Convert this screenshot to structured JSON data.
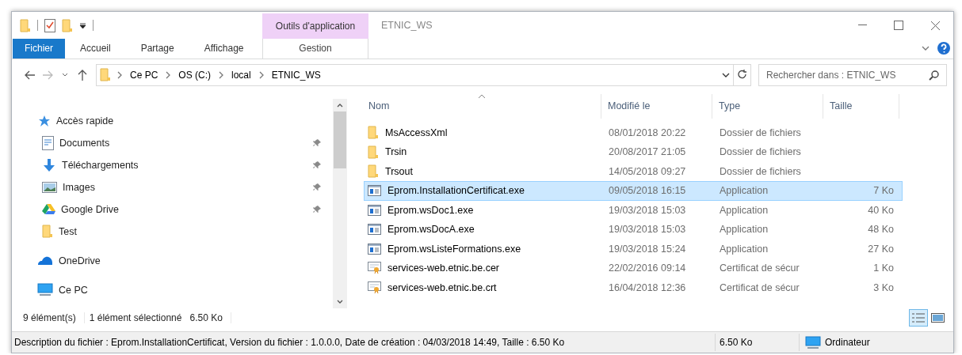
{
  "window": {
    "title": "ETNIC_WS",
    "context_tab": "Outils d'application"
  },
  "ribbon_tabs": [
    {
      "label": "Fichier",
      "kind": "file"
    },
    {
      "label": "Accueil",
      "kind": "tab"
    },
    {
      "label": "Partage",
      "kind": "tab"
    },
    {
      "label": "Affichage",
      "kind": "tab"
    },
    {
      "label": "Gestion",
      "kind": "context"
    }
  ],
  "address": {
    "path": [
      "Ce PC",
      "OS (C:)",
      "local",
      "ETNIC_WS"
    ]
  },
  "search": {
    "placeholder": "Rechercher dans : ETNIC_WS"
  },
  "navigation": [
    {
      "label": "Accès rapide",
      "kind": "star",
      "children": [
        {
          "label": "Documents",
          "kind": "documents",
          "pinned": true
        },
        {
          "label": "Téléchargements",
          "kind": "download",
          "pinned": true
        },
        {
          "label": "Images",
          "kind": "images",
          "pinned": true
        },
        {
          "label": "Google Drive",
          "kind": "drive",
          "pinned": true
        },
        {
          "label": "Test",
          "kind": "folder",
          "pinned": false
        }
      ]
    },
    {
      "label": "OneDrive",
      "kind": "cloud"
    },
    {
      "label": "Ce PC",
      "kind": "computer"
    }
  ],
  "columns": [
    {
      "label": "Nom",
      "sorted": true
    },
    {
      "label": "Modifié le",
      "sorted": false
    },
    {
      "label": "Type",
      "sorted": false
    },
    {
      "label": "Taille",
      "sorted": false
    }
  ],
  "files": [
    {
      "name": "MsAccessXml",
      "modified": "08/01/2018 20:22",
      "type": "Dossier de fichiers",
      "kind": "folder",
      "selected": false
    },
    {
      "name": "Trsin",
      "modified": "20/08/2017 21:05",
      "type": "Dossier de fichiers",
      "kind": "folder",
      "selected": false
    },
    {
      "name": "Trsout",
      "modified": "14/05/2018 09:27",
      "type": "Dossier de fichiers",
      "kind": "folder",
      "selected": false
    },
    {
      "name": "Eprom.InstallationCertificat.exe",
      "modified": "09/05/2018 16:15",
      "type": "Application",
      "size": "7 Ko",
      "kind": "app",
      "selected": true
    },
    {
      "name": "Eprom.wsDoc1.exe",
      "modified": "19/03/2018 15:03",
      "type": "Application",
      "size": "40 Ko",
      "kind": "app",
      "selected": false
    },
    {
      "name": "Eprom.wsDocA.exe",
      "modified": "19/03/2018 15:03",
      "type": "Application",
      "size": "48 Ko",
      "kind": "app",
      "selected": false
    },
    {
      "name": "Eprom.wsListeFormations.exe",
      "modified": "19/03/2018 15:24",
      "type": "Application",
      "size": "27 Ko",
      "kind": "app",
      "selected": false
    },
    {
      "name": "services-web.etnic.be.cer",
      "modified": "22/02/2016 09:14",
      "type": "Certificat de sécur",
      "size": "1 Ko",
      "kind": "cert",
      "selected": false
    },
    {
      "name": "services-web.etnic.be.crt",
      "modified": "16/04/2018 12:36",
      "type": "Certificat de sécur",
      "size": "3 Ko",
      "kind": "cert",
      "selected": false
    }
  ],
  "status_bar": {
    "count": "9 élément(s)",
    "selection": "1 élément sélectionné",
    "selection_size": "6.50 Ko"
  },
  "view_buttons": [
    {
      "kind": "details",
      "selected": true
    },
    {
      "kind": "tiles",
      "selected": false
    }
  ],
  "details_bar": {
    "description": "Description du fichier : Eprom.InstallationCertificat, Version du fichier : 1.0.0.0, Date de création : 04/03/2018 14:49, Taille : 6.50 Ko",
    "size": "6.50 Ko",
    "location": "Ordinateur"
  }
}
